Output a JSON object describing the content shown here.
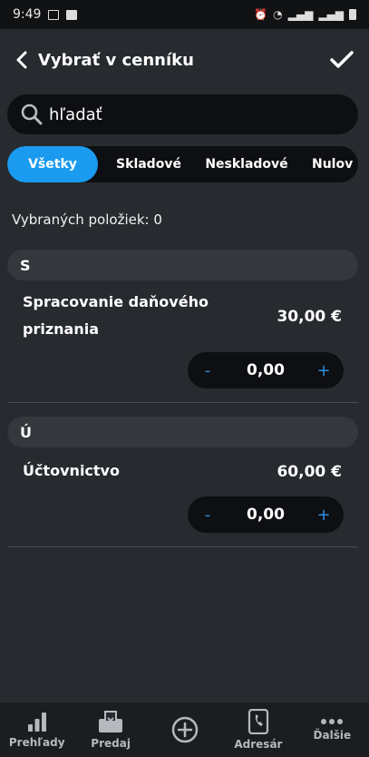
{
  "status_bar": {
    "time": "9:49"
  },
  "header": {
    "title": "Vybrať v cenníku"
  },
  "search": {
    "placeholder": "hľadať"
  },
  "tabs": [
    {
      "label": "Všetky",
      "active": true
    },
    {
      "label": "Skladové",
      "active": false
    },
    {
      "label": "Neskladové",
      "active": false
    },
    {
      "label": "Nulov",
      "active": false
    }
  ],
  "selected_count": "Vybraných položiek: 0",
  "sections": [
    {
      "letter": "S",
      "item_name": "Spracovanie daňového priznania",
      "price": "30,00 €",
      "quantity": "0,00"
    },
    {
      "letter": "Ú",
      "item_name": "Účtovnictvo",
      "price": "60,00 €",
      "quantity": "0,00"
    }
  ],
  "stepper": {
    "minus": "-",
    "plus": "+"
  },
  "bottom_nav": [
    {
      "label": "Prehľady",
      "icon": "bar-chart-icon"
    },
    {
      "label": "Predaj",
      "icon": "sale-icon"
    },
    {
      "label": "",
      "icon": "add-circle-icon"
    },
    {
      "label": "Adresár",
      "icon": "contacts-icon"
    },
    {
      "label": "Ďalšie",
      "icon": "more-icon"
    }
  ],
  "colors": {
    "background": "#272a2f",
    "accent": "#1a9bf0",
    "stepper_accent": "#2f8fe0",
    "input_bg": "#0d0f12",
    "section_bg": "#34373c"
  }
}
